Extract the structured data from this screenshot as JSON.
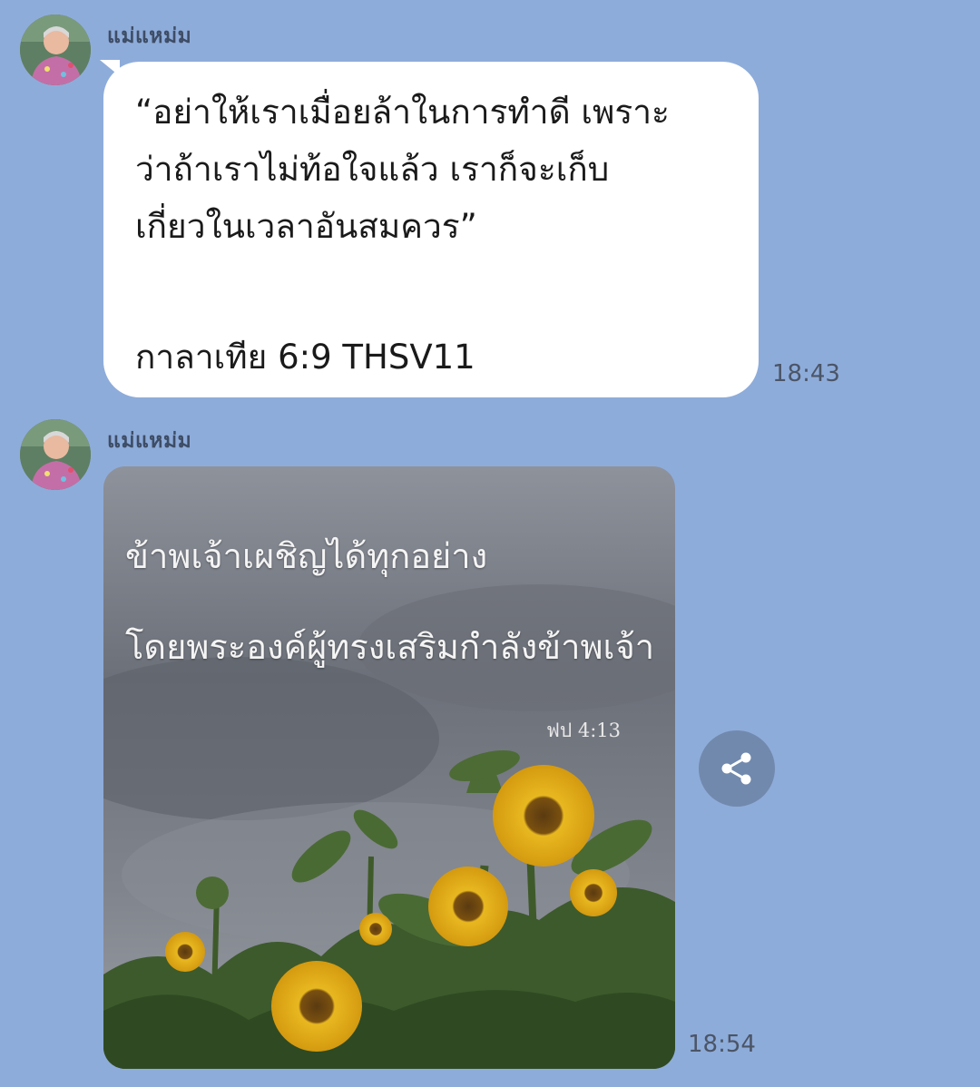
{
  "messages": [
    {
      "sender": "แม่แหม่ม",
      "quote": "“อย่าให้เราเมื่อยล้าในการทำดี เพราะ\nว่าถ้าเราไม่ท้อใจแล้ว เราก็จะเก็บ\nเกี่ยวในเวลาอันสมควร”",
      "reference": "กาลาเทีย 6:9 THSV11",
      "time": "18:43"
    },
    {
      "sender": "แม่แหม่ม",
      "image_line1": "ข้าพเจ้าเผชิญได้ทุกอย่าง",
      "image_line2": "โดยพระองค์ผู้ทรงเสริมกำลังข้าพเจ้า",
      "image_ref": "ฟป 4:13",
      "time": "18:54"
    }
  ],
  "icons": {
    "share": "share-icon"
  },
  "colors": {
    "background": "#8eacda",
    "bubble": "#ffffff",
    "share_button": "#7189ad"
  }
}
